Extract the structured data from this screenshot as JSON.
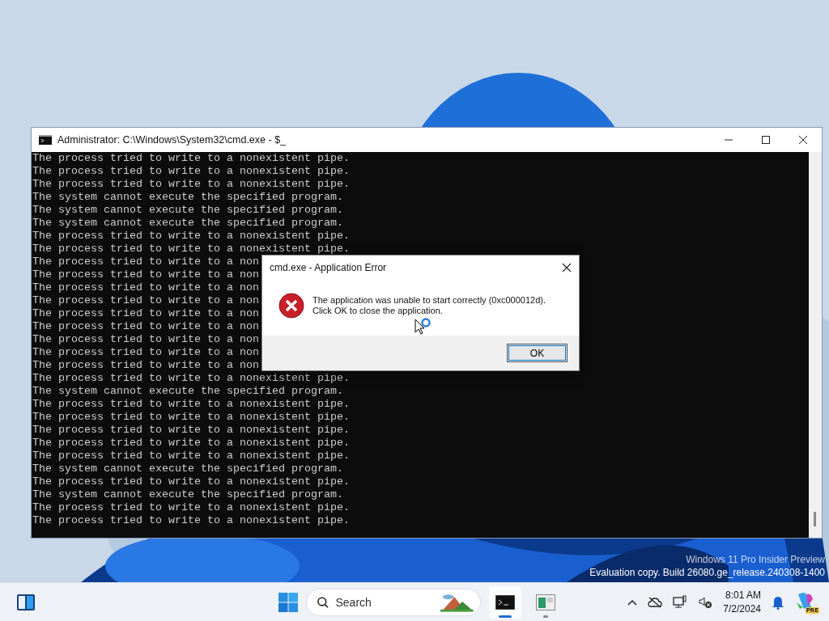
{
  "window": {
    "title": "Administrator: C:\\Windows\\System32\\cmd.exe - $_",
    "console_lines": [
      "The process tried to write to a nonexistent pipe.",
      "The process tried to write to a nonexistent pipe.",
      "The process tried to write to a nonexistent pipe.",
      "The system cannot execute the specified program.",
      "The system cannot execute the specified program.",
      "The system cannot execute the specified program.",
      "The process tried to write to a nonexistent pipe.",
      "The process tried to write to a nonexistent pipe.",
      "The process tried to write to a non",
      "The process tried to write to a non",
      "The process tried to write to a non",
      "The process tried to write to a non",
      "The process tried to write to a non",
      "The process tried to write to a non",
      "The process tried to write to a non",
      "The process tried to write to a non",
      "The process tried to write to a non",
      "The process tried to write to a nonexistent pipe.",
      "The system cannot execute the specified program.",
      "The process tried to write to a nonexistent pipe.",
      "The process tried to write to a nonexistent pipe.",
      "The process tried to write to a nonexistent pipe.",
      "The process tried to write to a nonexistent pipe.",
      "The process tried to write to a nonexistent pipe.",
      "The system cannot execute the specified program.",
      "The process tried to write to a nonexistent pipe.",
      "The system cannot execute the specified program.",
      "The process tried to write to a nonexistent pipe.",
      "The process tried to write to a nonexistent pipe."
    ]
  },
  "dialog": {
    "title": "cmd.exe - Application Error",
    "message_lines": [
      "The application was unable to start correctly (0xc000012d).",
      "Click OK to close the application."
    ],
    "button": "OK"
  },
  "watermark": [
    "Windows 11 Pro Insider Preview",
    "Evaluation copy. Build 26080.ge_release.240308-1400"
  ],
  "taskbar": {
    "search": {
      "placeholder": "Search"
    },
    "apps": [
      {
        "kind": "terminal",
        "selected": true
      },
      {
        "kind": "app",
        "selected": false
      }
    ],
    "clock": {
      "time": "8:01 AM",
      "date": "7/2/2024"
    },
    "copilot_badge": "PRE"
  }
}
